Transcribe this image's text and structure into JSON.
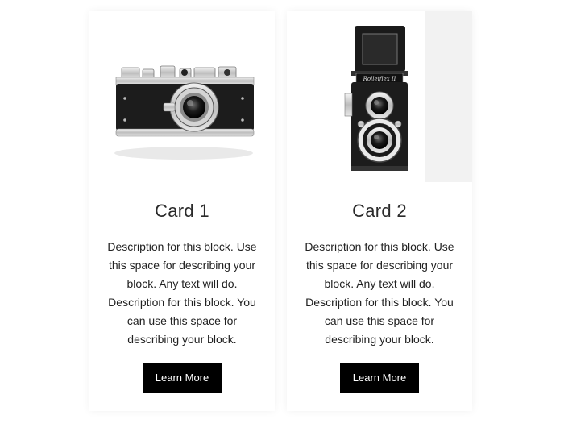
{
  "cards": [
    {
      "title": "Card 1",
      "description": "Description for this block. Use this space for describing your block. Any text will do. Description for this block. You can use this space for describing your block.",
      "button_label": "Learn More",
      "image": "rangefinder-camera"
    },
    {
      "title": "Card 2",
      "description": "Description for this block. Use this space for describing your block. Any text will do. Description for this block. You can use this space for describing your block.",
      "button_label": "Learn More",
      "image": "twin-lens-reflex-camera"
    }
  ],
  "colors": {
    "button_bg": "#000000",
    "button_text": "#ffffff",
    "card_bg": "#ffffff"
  }
}
